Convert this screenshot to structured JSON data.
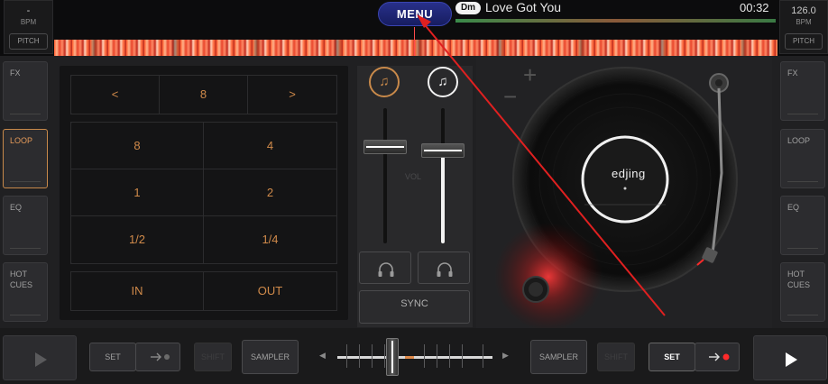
{
  "left_deck": {
    "bpm": "-",
    "bpm_label": "BPM",
    "pitch_label": "PITCH"
  },
  "right_deck": {
    "bpm": "126.0",
    "bpm_label": "BPM",
    "pitch_label": "PITCH"
  },
  "menu_label": "MENU",
  "track": {
    "key": "Dm",
    "title": "Love Got You",
    "time": "00:32"
  },
  "left_side": [
    {
      "label": "FX",
      "active": false
    },
    {
      "label": "LOOP",
      "active": true
    },
    {
      "label": "EQ",
      "active": false
    },
    {
      "label": "HOT\nCUES",
      "active": false
    }
  ],
  "right_side": [
    {
      "label": "FX"
    },
    {
      "label": "LOOP"
    },
    {
      "label": "EQ"
    },
    {
      "label": "HOT\nCUES"
    }
  ],
  "loop_panel": {
    "prev": "<",
    "value": "8",
    "next": ">",
    "grid": [
      "8",
      "4",
      "1",
      "2",
      "1/2",
      "1/4"
    ],
    "in": "IN",
    "out": "OUT"
  },
  "mixer": {
    "vol_label": "VOL",
    "sync_label": "SYNC"
  },
  "turntable": {
    "brand": "edjing"
  },
  "bottom": {
    "set_left": "SET",
    "set_right": "SET",
    "sampler_left": "SAMPLER",
    "sampler_right": "SAMPLER",
    "shift_left": "SHIFT",
    "shift_right": "SHIFT"
  },
  "colors": {
    "accent": "#e49a5a",
    "menu": "#1f2778",
    "cue_red": "#ff2a2a"
  }
}
